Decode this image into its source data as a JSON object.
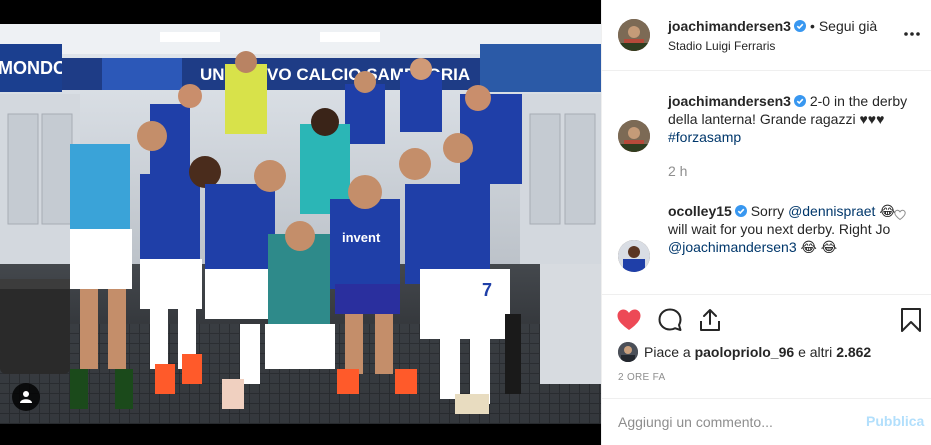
{
  "post": {
    "author": "joachimandersen3",
    "follow_status": "Segui già",
    "location": "Stadio Luigi Ferraris",
    "caption_author": "joachimandersen3",
    "caption_text": "2-0 in the derby della lanterna! Grande ragazzi ♥♥♥",
    "caption_hashtag": "#forzasamp",
    "caption_time": "2 h",
    "comment_author": "ocolley15",
    "comment_part1": "Sorry",
    "comment_mention1": "@dennispraet",
    "comment_part2": "😂will wait for you next derby. Right Jo",
    "comment_mention2": "@joachimandersen3",
    "comment_part3": "😂 😂",
    "likes_prefix": "Piace a",
    "likes_user": "paolopriolo_96",
    "likes_suffix": "e altri",
    "likes_count": "2.862",
    "time_ago": "2 ORE FA",
    "comment_placeholder": "Aggiungi un commento...",
    "publish_label": "Pubblica"
  },
  "photo": {
    "banner_left": "MONDO",
    "banner_center": "UN NUOVO CALCIO SAMPDORIA",
    "shirt_sponsor": "invent",
    "shirt_number": "7"
  },
  "colors": {
    "link": "#00376b",
    "verified": "#3897f0",
    "like_red": "#ed4956",
    "publish_disabled": "#b2dffc",
    "jersey_blue": "#1f3fa8"
  },
  "icons": {
    "verified": "verified-badge-icon",
    "more": "more-options-icon",
    "heart": "heart-icon",
    "comment": "comment-icon",
    "share": "share-icon",
    "save": "bookmark-icon",
    "tag": "user-tag-icon"
  }
}
